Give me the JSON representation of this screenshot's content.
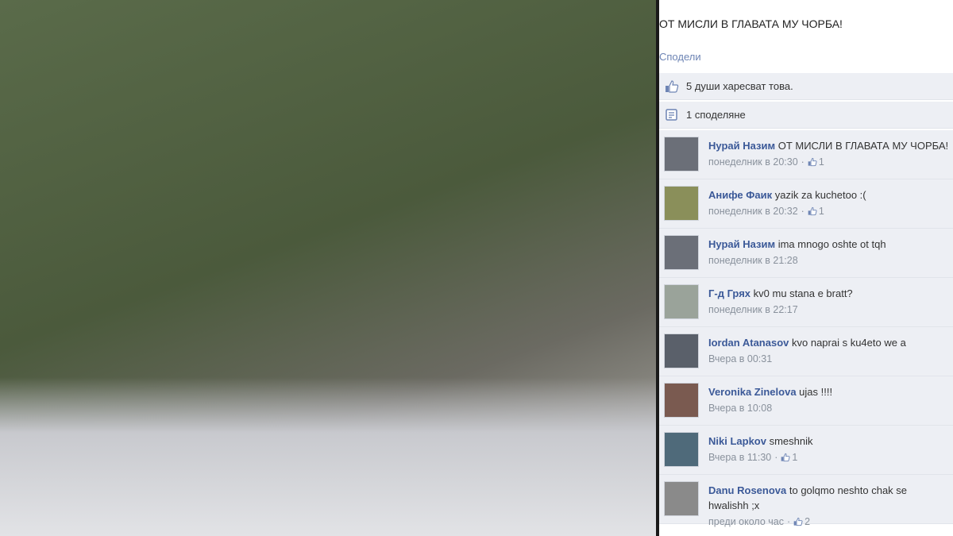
{
  "post": {
    "text": "ОТ МИСЛИ В ГЛАВАТА МУ ЧОРБА!",
    "share_label": "Сподели",
    "likes_text": "5 души харесват това.",
    "shares_text": "1 споделяне"
  },
  "comments": [
    {
      "author": "Нурай Назим",
      "text": "ОТ МИСЛИ В ГЛАВАТА МУ ЧОРБА!",
      "time": "понеделник в 20:30",
      "likes": "1",
      "avatar_color": "#6b6f78"
    },
    {
      "author": "Анифе Фаик",
      "text": "yazik za kuchetoo :(",
      "time": "понеделник в 20:32",
      "likes": "1",
      "avatar_color": "#8a8f5a"
    },
    {
      "author": "Нурай Назим",
      "text": "ima mnogo oshte ot tqh",
      "time": "понеделник в 21:28",
      "likes": "",
      "avatar_color": "#6b6f78"
    },
    {
      "author": "Г-д Грях",
      "text": "kv0 mu stana e bratt?",
      "time": "понеделник в 22:17",
      "likes": "",
      "avatar_color": "#9aa39a"
    },
    {
      "author": "Iordan Atanasov",
      "text": "kvo naprai s ku4eto we a",
      "time": "Вчера в 00:31",
      "likes": "",
      "avatar_color": "#5a606a"
    },
    {
      "author": "Veronika Zinelova",
      "text": "ujas !!!!",
      "time": "Вчера в 10:08",
      "likes": "",
      "avatar_color": "#7a5a50"
    },
    {
      "author": "Niki Lapkov",
      "text": "smeshnik",
      "time": "Вчера в 11:30",
      "likes": "1",
      "avatar_color": "#4f6a7a"
    },
    {
      "author": "Danu Rosenova",
      "text": "to golqmo neshto chak se hwalishh ;x",
      "time": "преди около час",
      "likes": "2",
      "avatar_color": "#8a8a8a"
    }
  ],
  "colors": {
    "link": "#3b5998",
    "row_bg": "#edeff4",
    "meta": "#89919c"
  }
}
